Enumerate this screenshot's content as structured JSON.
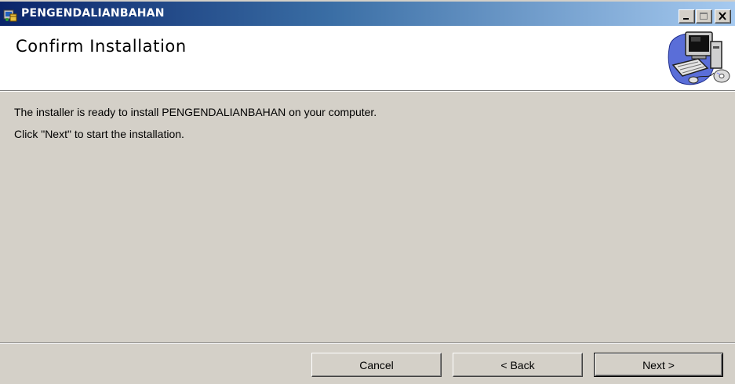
{
  "window": {
    "title": "PENGENDALIANBAHAN",
    "icon": "installer-icon",
    "controls": {
      "minimize": "minimize-icon",
      "maximize": "maximize-icon",
      "close": "close-icon"
    }
  },
  "header": {
    "title": "Confirm Installation",
    "art": "computer-cd-icon"
  },
  "body": {
    "line1": "The installer is ready to install PENGENDALIANBAHAN on your computer.",
    "line2": "Click \"Next\" to start the installation."
  },
  "buttons": {
    "cancel": "Cancel",
    "back": "< Back",
    "next": "Next >"
  },
  "colors": {
    "titlebar_start": "#0a246a",
    "titlebar_end": "#a6caf0",
    "face": "#d4d0c8"
  }
}
